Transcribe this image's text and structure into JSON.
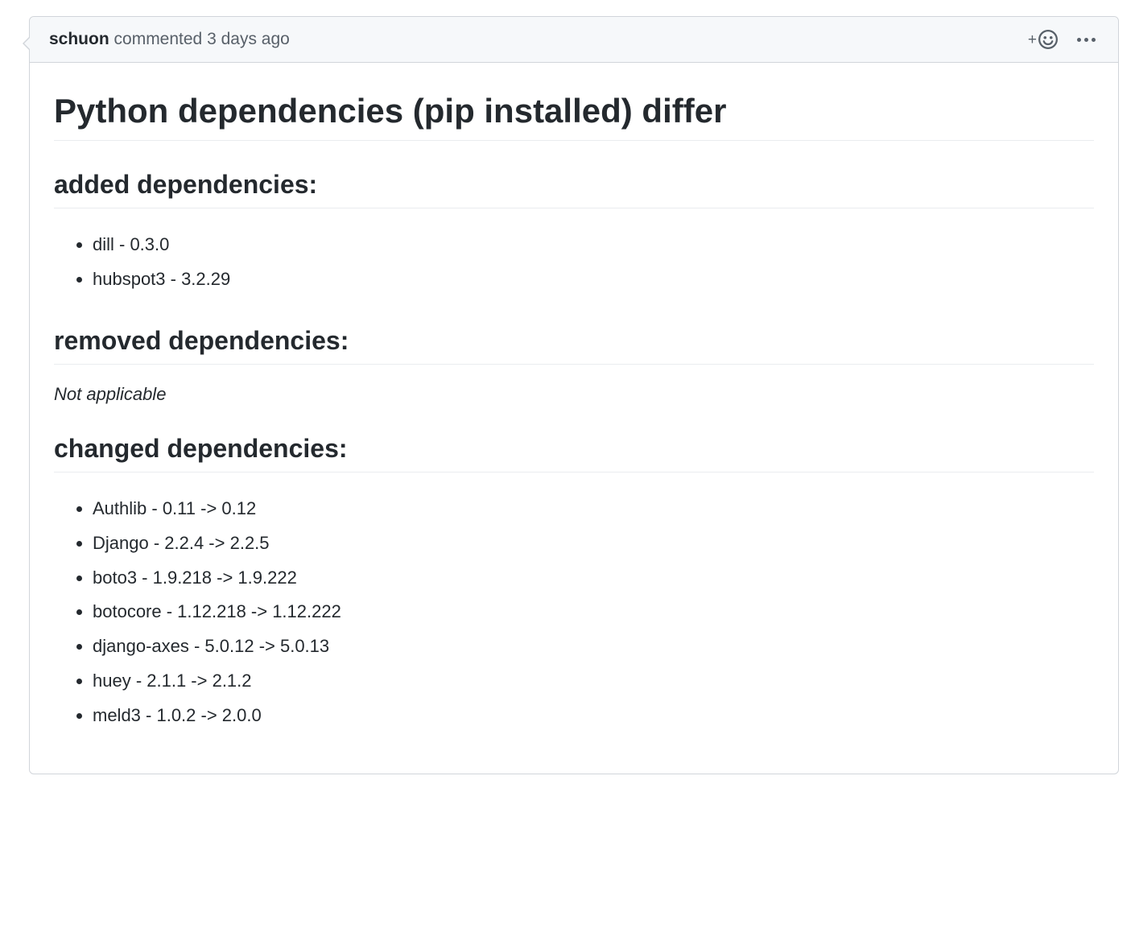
{
  "header": {
    "author": "schuon",
    "action": "commented",
    "timestamp": "3 days ago",
    "reaction_plus": "+"
  },
  "body": {
    "title": "Python dependencies (pip installed) differ",
    "sections": {
      "added": {
        "heading": "added dependencies:",
        "items": [
          "dill - 0.3.0",
          "hubspot3 - 3.2.29"
        ]
      },
      "removed": {
        "heading": "removed dependencies:",
        "placeholder": "Not applicable"
      },
      "changed": {
        "heading": "changed dependencies:",
        "items": [
          "Authlib - 0.11 -> 0.12",
          "Django - 2.2.4 -> 2.2.5",
          "boto3 - 1.9.218 -> 1.9.222",
          "botocore - 1.12.218 -> 1.12.222",
          "django-axes - 5.0.12 -> 5.0.13",
          "huey - 2.1.1 -> 2.1.2",
          "meld3 - 1.0.2 -> 2.0.0"
        ]
      }
    }
  }
}
